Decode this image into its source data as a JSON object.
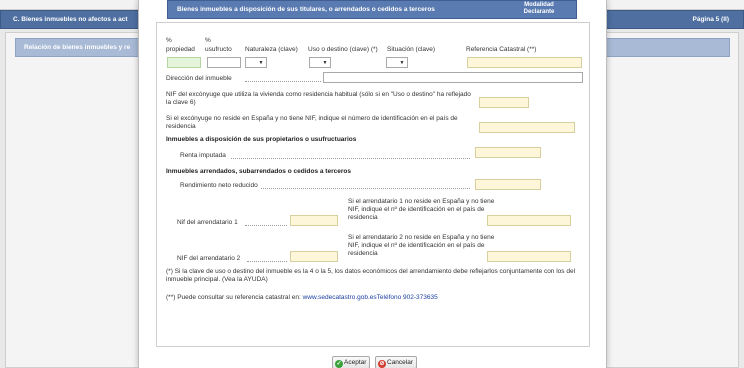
{
  "background": {
    "header_title": "C. Bienes inmuebles no afectos a act",
    "header_page": "Página 5 (II)",
    "subheader_title": "Relación de bienes inmuebles y re"
  },
  "modal": {
    "title": "Bienes inmuebles a disposición de sus titulares, o arrendados o cedidos a terceros",
    "modalidad_line1": "Modalidad",
    "modalidad_line2": "Declarante"
  },
  "form": {
    "col_pct1": "%",
    "col_propiedad": "propiedad",
    "col_pct2": "%",
    "col_usufructo": "usufructo",
    "col_naturaleza": "Naturaleza (clave)",
    "col_uso": "Uso o destino (clave) (*)",
    "col_situacion": "Situación (clave)",
    "col_refcat": "Referencia Catastral (**)",
    "direccion": "Dirección del inmueble",
    "nif_conyuge": "NIF del excónyuge que utiliza la vivienda como residencia habitual (sólo si en \"Uso o destino\" ha reflejado la clave 6)",
    "no_reside": "Si el excónyuge no reside en España y no tiene NIF, indique el número de identificación en el país de residencia",
    "sec_disposicion": "Inmuebles a disposición de sus propietarios o usufructuarios",
    "renta_imputada": "Renta imputada",
    "sec_arrendados": "Inmuebles arrendados, subarrendados o cedidos a terceros",
    "rendimiento": "Rendimiento neto reducido",
    "nif_arr1": "Nif del arrendatario 1",
    "arr1_no_reside": "Si el arrendatario 1 no reside en España y no tiene NIF, indique el nº de identificación en el país de residencia",
    "nif_arr2": "NIF del arrendatario 2",
    "arr2_no_reside": "Si el arrendatario 2 no reside en España y no tiene NIF, indique el nº de identificación en el país de residencia",
    "note1": "(*) Si la clave de uso o destino del inmueble es la 4 o la 5, los datos económicos del arrendamiento debe reflejarlos conjuntamente con los del inmueble principal. (Vea la AYUDA)",
    "note2_prefix": "(**) Puede consultar su referencia catastral en: ",
    "note2_link": "www.sedecatastro.gob.es",
    "note2_phone": "Teléfono 902-373635"
  },
  "buttons": {
    "accept": "Aceptar",
    "cancel": "Cancelar"
  },
  "icons": {
    "dropdown": "chevron-down-icon",
    "accept": "check-circle-icon",
    "cancel": "cancel-circle-icon"
  }
}
